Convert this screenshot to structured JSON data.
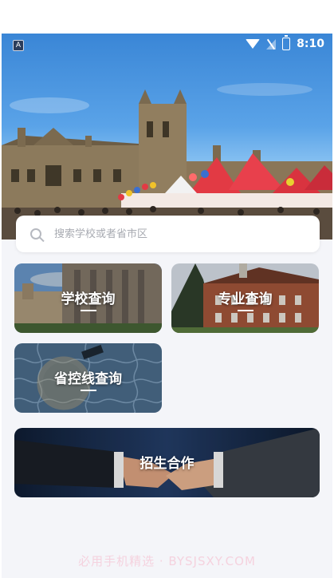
{
  "status_bar": {
    "time": "8:10",
    "notification_icon": "A"
  },
  "search": {
    "placeholder": "搜索学校或者省市区"
  },
  "cards": {
    "school": {
      "label": "学校查询"
    },
    "major": {
      "label": "专业查询"
    },
    "score_line": {
      "label": "省控线查询"
    },
    "cooperation": {
      "label": "招生合作"
    }
  },
  "watermark": "必用手机精选 · BYSJSXY.COM",
  "colors": {
    "background": "#f4f5f9",
    "card_text": "#ffffff",
    "search_bg": "#ffffff"
  }
}
